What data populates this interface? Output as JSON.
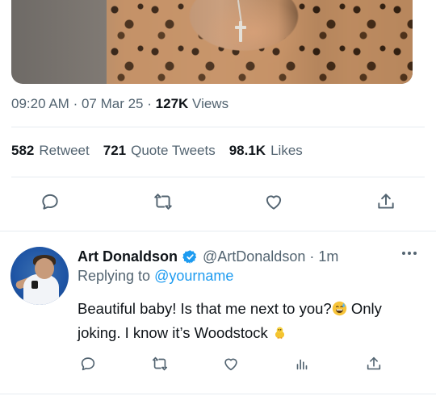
{
  "tweet": {
    "time": "09:20 AM",
    "separator": "·",
    "date": "07 Mar 25",
    "views_count": "127K",
    "views_label": "Views"
  },
  "stats": {
    "retweets_count": "582",
    "retweets_label": "Retweet",
    "quotes_count": "721",
    "quotes_label": "Quote Tweets",
    "likes_count": "98.1K",
    "likes_label": "Likes"
  },
  "reply": {
    "name": "Art Donaldson",
    "handle": "@ArtDonaldson",
    "separator": "·",
    "time": "1m",
    "replying_prefix": "Replying to",
    "replying_to": "@yourname",
    "text_part1": "Beautiful baby! Is that me next to you?",
    "text_part2": " Only joking. I know it’s Woodstock ",
    "verified_color": "#1d9bf0"
  },
  "icons": {
    "main_actions": [
      "reply-icon",
      "retweet-icon",
      "like-icon",
      "share-icon"
    ],
    "reply_actions": [
      "reply-icon",
      "retweet-icon",
      "like-icon",
      "analytics-icon",
      "share-icon"
    ]
  }
}
